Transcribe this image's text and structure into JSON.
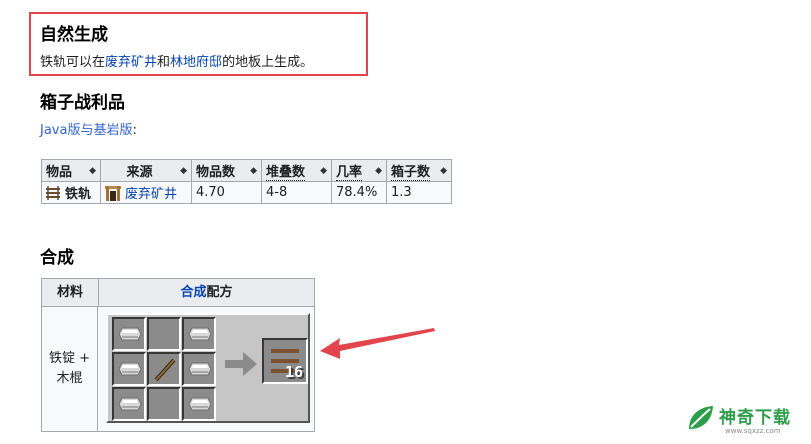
{
  "natural": {
    "heading": "自然生成",
    "text_pre": "铁轨可以在",
    "link1": "废弃矿井",
    "text_mid": "和",
    "link2": "林地府邸",
    "text_post": "的地板上生成。"
  },
  "chest": {
    "heading": "箱子战利品",
    "edition_link": "Java版与基岩版",
    "edition_suffix": ":",
    "columns": [
      "物品",
      "来源",
      "物品数",
      "堆叠数",
      "几率",
      "箱子数"
    ],
    "row": {
      "item": "铁轨",
      "source": "废弃矿井",
      "count": "4.70",
      "stack": "4-8",
      "chance": "78.4%",
      "chests": "1.3"
    }
  },
  "crafting": {
    "heading": "合成",
    "col_material": "材料",
    "col_recipe_link": "合成",
    "col_recipe_text": "配方",
    "materials_line1": "铁锭 +",
    "materials_line2": "木棍",
    "grid": [
      "iron-ingot",
      "empty",
      "iron-ingot",
      "iron-ingot",
      "stick",
      "iron-ingot",
      "iron-ingot",
      "empty",
      "iron-ingot"
    ],
    "output_item": "rail",
    "output_count": "16"
  },
  "watermark": {
    "name": "神奇下载",
    "url": "www.sqxzz.com"
  },
  "colors": {
    "highlight_box": "#e2454b",
    "link": "#0645ad",
    "watermark_green": "#2e9e4a"
  }
}
